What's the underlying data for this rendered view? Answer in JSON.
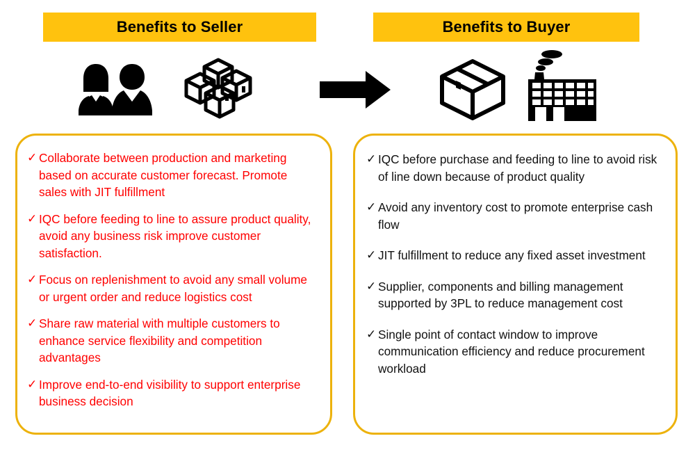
{
  "theme": {
    "banner_background": "#FFC20E",
    "panel_border": "#EDB20C",
    "seller_text_color": "#FF0000",
    "buyer_text_color": "#111111",
    "page_background": "#FFFFFF"
  },
  "columns": {
    "seller": {
      "banner_title": "Benefits to Seller",
      "icons": [
        "people-icon",
        "boxes-stack-icon"
      ],
      "check_glyph": "✓",
      "bullets": [
        "Collaborate between production and marketing based on accurate customer forecast. Promote sales with JIT fulfillment",
        "IQC before feeding to line to assure product quality, avoid any business risk improve customer satisfaction.",
        "Focus on replenishment to avoid any small volume or urgent order and reduce logistics cost",
        "Share raw material with multiple customers to enhance service flexibility and competition advantages",
        "Improve end-to-end visibility to support enterprise business decision"
      ]
    },
    "buyer": {
      "banner_title": "Benefits to Buyer",
      "icons": [
        "box-icon",
        "factory-icon"
      ],
      "check_glyph": "✓",
      "bullets": [
        "IQC before purchase and feeding to line to avoid risk of line down because of product quality",
        "Avoid any inventory cost to promote enterprise cash flow",
        "JIT fulfillment to reduce any fixed asset investment",
        "Supplier, components and billing management supported by 3PL to reduce management cost",
        "Single point of contact window to improve communication efficiency and reduce procurement workload"
      ]
    }
  },
  "flow": {
    "arrow_icon": "right-arrow-icon",
    "direction": "seller-to-buyer"
  }
}
